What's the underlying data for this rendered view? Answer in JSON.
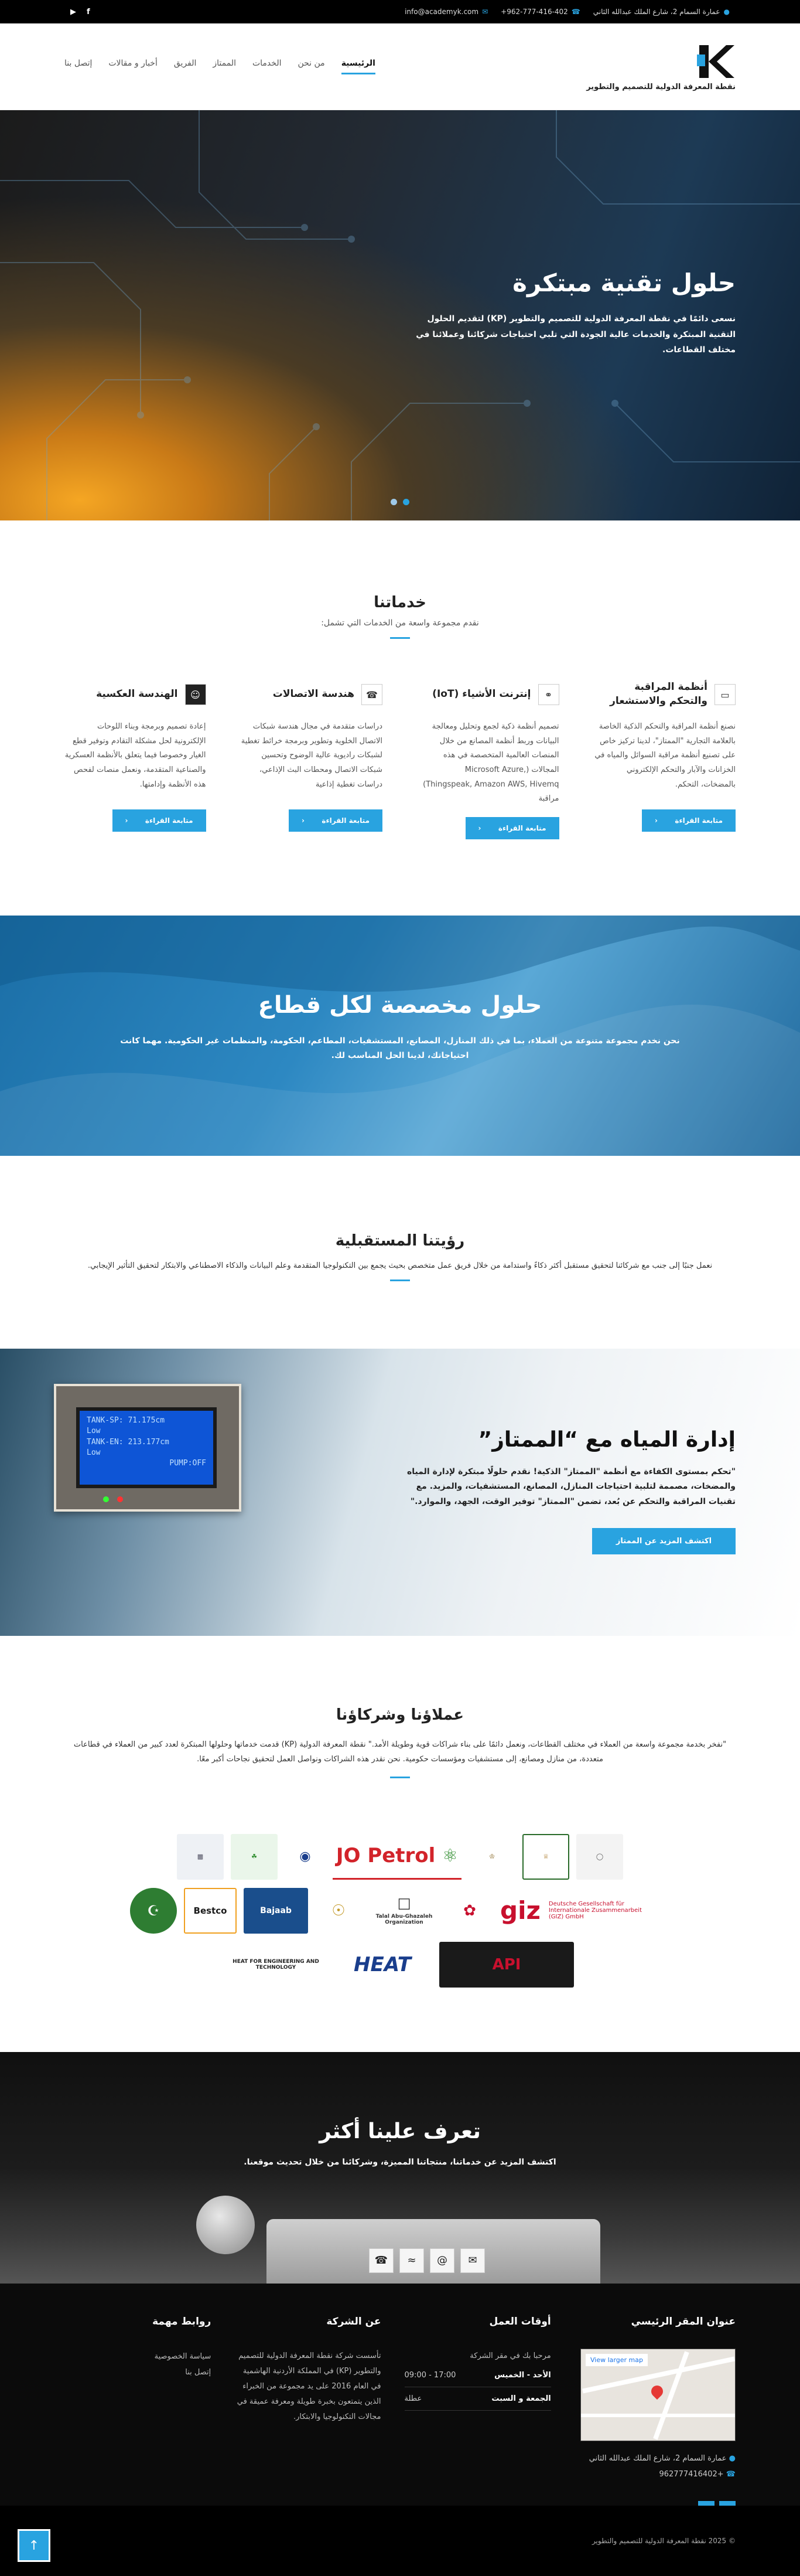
{
  "topbar": {
    "address": "عمارة السمام 2، شارع الملك عبدالله الثاني",
    "phone": "+962-777-416-402",
    "email": "info@academyk.com"
  },
  "header": {
    "tagline": "نقطة المعرفة الدولية للتصميم والتطوير",
    "nav": [
      "الرئيسية",
      "من نحن",
      "الخدمات",
      "الممتاز",
      "الفريق",
      "أخبار و مقالات",
      "إتصل بنا"
    ]
  },
  "hero": {
    "title": "حلول تقنية مبتكرة",
    "text": "نسعى دائمًا في نقطة المعرفة الدولية للتصميم والتطوير (KP) لتقديم الحلول التقنية المبتكرة والخدمات عالية الجودة التي تلبي احتياجات شركائنا وعملائنا في مختلف القطاعات."
  },
  "services": {
    "title": "خدماتنا",
    "subtitle": "نقدم مجموعة واسعة من الخدمات التي تشمل:",
    "button_label": "متابعة القراءة",
    "items": [
      {
        "title": "أنظمة المراقبة والتحكم والاستشعار",
        "icon": "monitor-icon",
        "text": "نصنع أنظمة المراقبة والتحكم الذكية الخاصة بالعلامة التجارية \"الممتاز\"، لدينا تركيز خاص على تصنيع أنظمة مراقبة السوائل والمياه في الخزانات والآبار والتحكم الإلكتروني بالمضخات، التحكم."
      },
      {
        "title": "إنترنت الأشياء (IoT)",
        "icon": "globe-icon",
        "text": "تصميم أنظمة ذكية لجمع وتحليل ومعالجة البيانات وربط أنظمة المصانع من خلال المنصات العالمية المتخصصة في هذه المجالات (Microsoft Azure, Thingspeak, Amazon AWS, Hivemq) مراقبة"
      },
      {
        "title": "هندسة الاتصالات",
        "icon": "phone-icon",
        "text": "دراسات متقدمة في مجال هندسة شبكات الاتصال الخلوية وتطوير وبرمجة خرائط تغطية لشبكات راديوية عالية الوضوح وتحسين شبكات الاتصال ومحطات البث الإذاعي، دراسات تغطية إذاعية"
      },
      {
        "title": "الهندسة العكسية",
        "icon": "users-icon",
        "text": "إعادة تصميم وبرمجة وبناء اللوحات الإلكترونية لحل مشكلة التقادم وتوفير قطع الغيار وخصوصا فيما يتعلق بالأنظمة العسكرية والصناعية المتقدمة، ونعمل منصات لفحص هذه الأنظمة وإدامتها."
      }
    ]
  },
  "banner": {
    "title": "حلول مخصصة لكل قطاع",
    "text": "نحن نخدم مجموعة متنوعة من العملاء، بما في ذلك المنازل، المصانع، المستشفيات، المطاعم، الحكومة، والمنظمات غير الحكومية. مهما كانت احتياجاتك، لدينا الحل المناسب لك."
  },
  "vision": {
    "title": "رؤيتنا المستقبلية",
    "text": "نعمل جنبًا إلى جنب مع شركائنا لتحقيق مستقبل أكثر ذكاءً واستدامة من خلال فريق عمل متخصص بحيث يجمع بين التكنولوجيا المتقدمة وعلم البيانات والذكاء الاصطناعي والابتكار لتحقيق التأثير الإيجابي."
  },
  "water": {
    "title": "إدارة المياه مع “الممتاز”",
    "text": "\"تحكم بمستوى الكفاءة مع أنظمة \"الممتاز\" الذكية! نقدم حلولًا مبتكرة لإدارة المياه والمضخات، مصممة لتلبية احتياجات المنازل، المصانع، المستشفيات، والمزيد. مع تقنيات المراقبة والتحكم عن بُعد، تضمن \"الممتاز\" توفير الوقت، الجهد، والموارد.\"",
    "button_label": "اكتشف المزيد عن الممتاز",
    "screen": [
      "TANK-SP: 71.175cm",
      "Low",
      "TANK-EN: 213.177cm",
      "Low",
      "PUMP:OFF"
    ]
  },
  "clients": {
    "title": "عملاؤنا وشركاؤنا",
    "text": "\"نفخر بخدمة مجموعة واسعة من العملاء في مختلف القطاعات، ونعمل دائمًا على بناء شراكات قوية وطويلة الأمد.\" نقطة المعرفة الدولية (KP) قدمت خدماتها وحلولها المبتكرة لعدد كبير من العملاء في قطاعات متعددة، من منازل ومصانع، إلى مستشفيات ومؤسسات حكومية. نحن نقدر هذه الشراكات ونواصل العمل لتحقيق نجاحات أكبر معًا.",
    "logos_row1": [
      "JO Petrol",
      "giz",
      "Deutsche Gesellschaft für Internationale Zusammenarbeit (GIZ) GmbH",
      "Talal Abu-Ghazaleh Organization",
      "Bajaab",
      "Bestco"
    ],
    "logos_row2": [
      "HEAT",
      "HEAT FOR ENGINEERING AND TECHNOLOGY",
      "API"
    ]
  },
  "know": {
    "title": "تعرف علينا أكثر",
    "text": "اكتشف المزيد عن خدماتنا، منتجاتنا المميزة، وشركائنا من خلال تحديث موقعنا."
  },
  "footer": {
    "address_title": "عنوان المقر الرئيسي",
    "map_link": "View larger map",
    "address": "عمارة السمام 2، شارع الملك عبدالله الثاني",
    "phone": "+962777416402",
    "hours_title": "أوقات العمل",
    "hours_note": "مرحبا بك في مقر الشركة",
    "hours": [
      {
        "day": "الأحد - الخميس",
        "time": "09:00 - 17:00"
      },
      {
        "day": "الجمعة و السبت",
        "time": "عطلة"
      }
    ],
    "about_title": "عن الشركة",
    "about_text": "تأسست شركة نقطة المعرفة الدولية للتصميم والتطوير (KP) في المملكة الأردنية الهاشمية في العام 2016 على يد مجموعة من الخبراء الذين يتمتعون بخبرة طويلة ومعرفة عميقة في مجالات التكنولوجيا والابتكار.",
    "links_title": "روابط مهمة",
    "links": [
      "سياسة الخصوصية",
      "إتصل بنا"
    ],
    "copyright": "© 2025 نقطة المعرفة الدولية للتصميم والتطوير"
  }
}
